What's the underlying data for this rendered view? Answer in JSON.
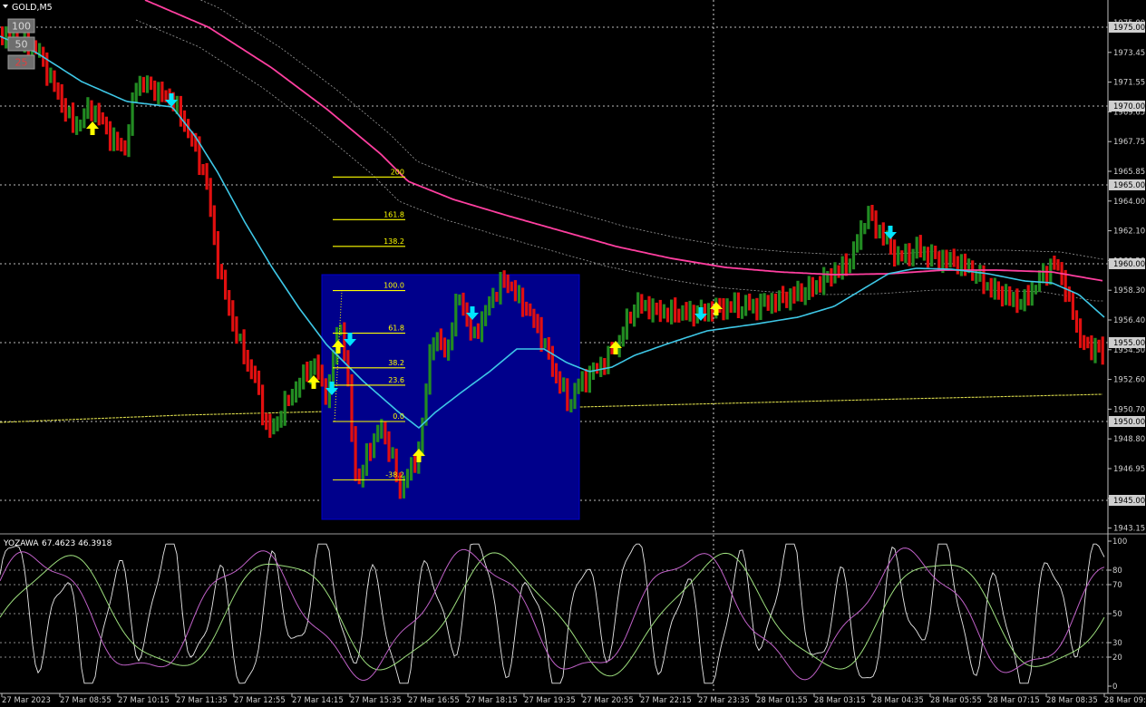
{
  "window": {
    "title": "GOLD,M5",
    "menu_icon": "triangle-down-icon"
  },
  "zoom_buttons": [
    "100",
    "50",
    "25"
  ],
  "indicator": {
    "name": "YOZAWA",
    "values": "67.4623 46.3918"
  },
  "price_axis": {
    "labels": [
      "1975.00",
      "1973.45",
      "1971.55",
      "1969.65",
      "1967.75",
      "1965.85",
      "1964.00",
      "1962.10",
      "1960.20",
      "1958.30",
      "1956.40",
      "1954.50",
      "1952.60",
      "1950.70",
      "1948.80",
      "1946.95",
      "1945.05",
      "1943.15"
    ],
    "highlighted": [
      "1975.00",
      "1970.00",
      "1965.00",
      "1960.00",
      "1955.00",
      "1950.00",
      "1945.00"
    ]
  },
  "osc_axis": {
    "labels": [
      "100",
      "80",
      "70",
      "50",
      "30",
      "20",
      "0"
    ]
  },
  "time_axis": {
    "labels": [
      "27 Mar 2023",
      "27 Mar 08:55",
      "27 Mar 10:15",
      "27 Mar 11:35",
      "27 Mar 12:55",
      "27 Mar 14:15",
      "27 Mar 15:35",
      "27 Mar 16:55",
      "27 Mar 18:15",
      "27 Mar 19:35",
      "27 Mar 20:55",
      "27 Mar 22:15",
      "27 Mar 23:35",
      "28 Mar 01:55",
      "28 Mar 03:15",
      "28 Mar 04:35",
      "28 Mar 05:55",
      "28 Mar 07:15",
      "28 Mar 08:35",
      "28 Mar 09:55"
    ]
  },
  "fibonacci": {
    "levels": [
      {
        "label": "200",
        "price": 1965.5
      },
      {
        "label": "161.8",
        "price": 1962.8
      },
      {
        "label": "138.2",
        "price": 1961.1
      },
      {
        "label": "100.0",
        "price": 1958.3
      },
      {
        "label": "61.8",
        "price": 1955.6
      },
      {
        "label": "38.2",
        "price": 1953.4
      },
      {
        "label": "23.6",
        "price": 1952.3
      },
      {
        "label": "0.0",
        "price": 1950.0
      },
      {
        "label": "-38.2",
        "price": 1946.3
      }
    ]
  },
  "colors": {
    "bull": "#228b22",
    "bear": "#e10f0f",
    "ma_fast": "#3ec7e6",
    "ma_slow": "#ff3fa0",
    "yellow_line": "#d8d84a",
    "fib": "#ffff00",
    "rectangle": "#00008b",
    "arrow_up": "#ffff00",
    "arrow_down": "#00e5ff",
    "osc_main": "#e8e8e8",
    "osc_signal": "#c061c8",
    "osc_slow": "#9ee07e"
  }
}
